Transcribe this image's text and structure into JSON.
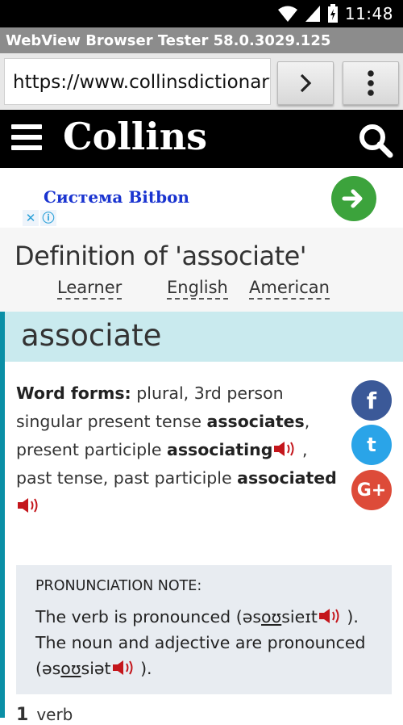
{
  "status_bar": {
    "time": "11:48",
    "icons": [
      "wifi-icon",
      "cell-signal-icon",
      "battery-icon"
    ]
  },
  "app": {
    "title": "WebView Browser Tester 58.0.3029.125"
  },
  "browser": {
    "url": "https://www.collinsdictionary",
    "go_icon": "chevron-right-icon",
    "menu_icon": "more-vert-icon"
  },
  "site": {
    "logo": "Collins",
    "menu_icon": "hamburger-icon",
    "search_icon": "search-icon"
  },
  "ad": {
    "title": "Система Bitbon",
    "close": "✕",
    "info": "ⓘ"
  },
  "page": {
    "title": "Definition of 'associate'",
    "tabs": [
      "Learner",
      "English",
      "American"
    ]
  },
  "entry": {
    "headword": "associate",
    "forms_label": "Word forms:",
    "forms_text1": " plural, 3rd person singular present tense ",
    "form1": "associates",
    "forms_text2": ", present participle ",
    "form2": "associating",
    "forms_text3": " , past tense, past participle ",
    "form3": "associated"
  },
  "social": [
    "f",
    "t",
    "G+"
  ],
  "pronunciation_note": {
    "title": "PRONUNCIATION NOTE:",
    "line1_a": "The verb is pronounced (əs",
    "line1_u": "oʊ",
    "line1_b": "sieɪt",
    "line1_c": " ).",
    "line2_a": "The noun and adjective are pronounced (əs",
    "line2_u": "oʊ",
    "line2_b": "siət",
    "line2_c": " )."
  },
  "sense": {
    "number": "1",
    "pos": "verb"
  },
  "colors": {
    "accent_teal": "#0a8fa6",
    "headword_band": "#c9eaee",
    "facebook": "#3b5998",
    "twitter": "#2aa4e8",
    "google_plus": "#dd4b39",
    "ad_title": "#1a34d0"
  }
}
